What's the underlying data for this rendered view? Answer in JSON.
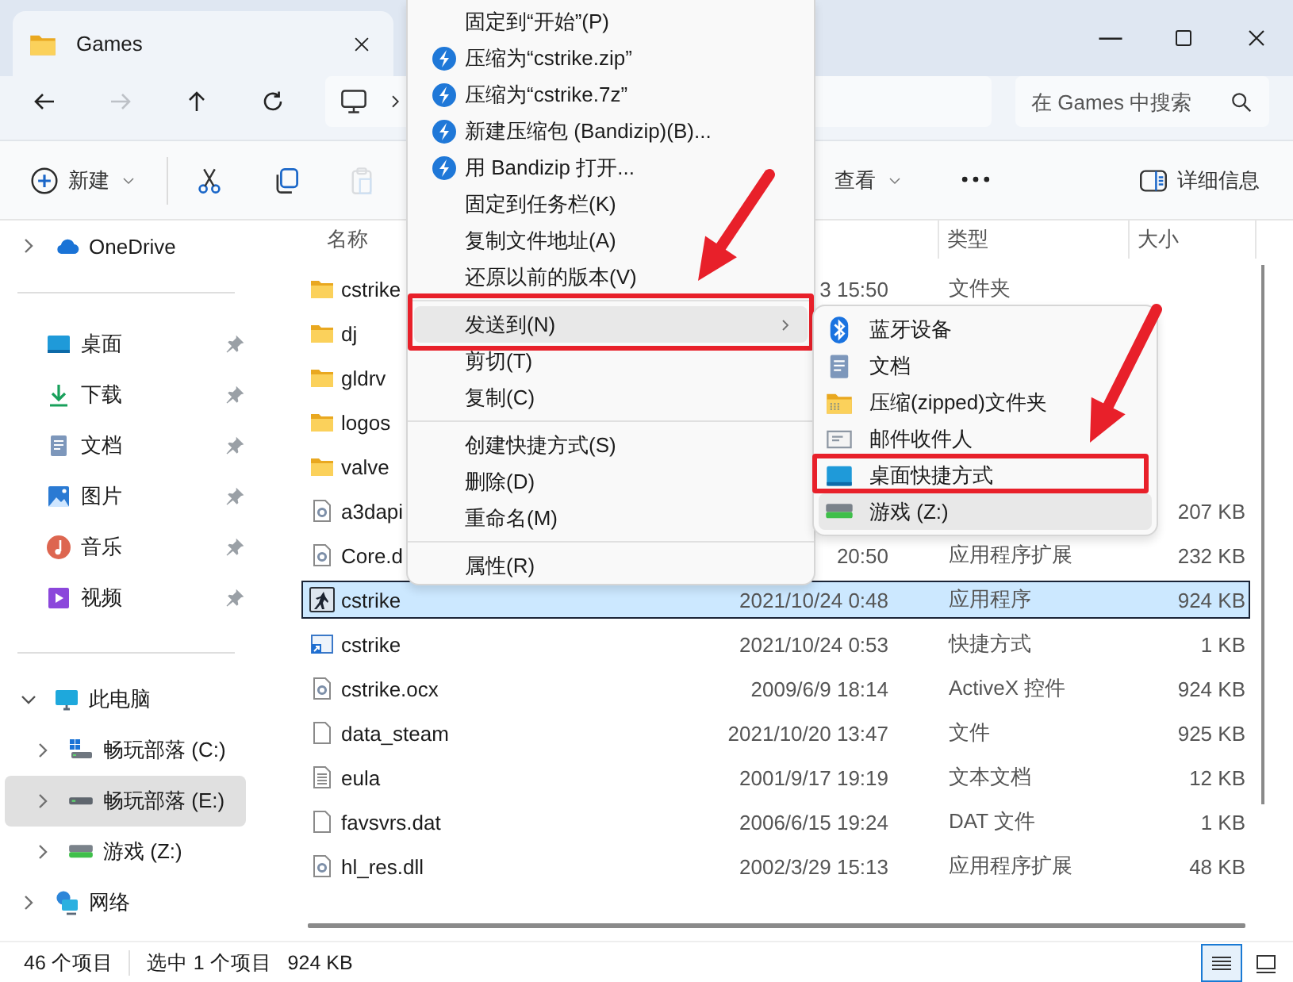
{
  "window": {
    "tab_title": "Games"
  },
  "nav": {
    "buttons": [
      {
        "kind": "back",
        "disabled": false
      },
      {
        "kind": "forward",
        "disabled": true
      },
      {
        "kind": "up",
        "disabled": false
      },
      {
        "kind": "refresh",
        "disabled": false
      }
    ],
    "search_placeholder": "在 Games 中搜索"
  },
  "toolbar": {
    "buttons": [
      {
        "kind": "new",
        "label": "新建",
        "disabled": false
      },
      {
        "kind": "cut",
        "disabled": false
      },
      {
        "kind": "copy",
        "disabled": false
      },
      {
        "kind": "paste",
        "disabled": true
      },
      {
        "kind": "view",
        "label": "查看",
        "disabled": false
      },
      {
        "kind": "more",
        "disabled": false
      },
      {
        "kind": "details",
        "label": "详细信息",
        "disabled": false
      }
    ]
  },
  "sidebar": {
    "sections": [
      {
        "items": [
          {
            "kind": "cloud",
            "label": "OneDrive",
            "expanded": false,
            "selected": false
          }
        ]
      },
      {
        "items": [
          {
            "kind": "desktop",
            "label": "桌面",
            "pinned": true,
            "selected": false
          },
          {
            "kind": "download",
            "label": "下载",
            "pinned": true,
            "selected": false
          },
          {
            "kind": "documents",
            "label": "文档",
            "pinned": true,
            "selected": false
          },
          {
            "kind": "pictures",
            "label": "图片",
            "pinned": true,
            "selected": false
          },
          {
            "kind": "music",
            "label": "音乐",
            "pinned": true,
            "selected": false
          },
          {
            "kind": "video",
            "label": "视频",
            "pinned": true,
            "selected": false
          }
        ]
      },
      {
        "items": [
          {
            "kind": "pc",
            "label": "此电脑",
            "expanded": true,
            "selected": false,
            "children": [
              {
                "kind": "system-drive",
                "label": "畅玩部落 (C:)",
                "expanded": false,
                "selected": false
              },
              {
                "kind": "drive",
                "label": "畅玩部落 (E:)",
                "expanded": false,
                "selected": true
              },
              {
                "kind": "green-drive",
                "label": "游戏 (Z:)",
                "expanded": false,
                "selected": false
              }
            ]
          },
          {
            "kind": "network",
            "label": "网络",
            "expanded": false,
            "selected": false
          }
        ]
      }
    ]
  },
  "table": {
    "columns": [
      {
        "kind": "name",
        "label": "名称"
      },
      {
        "kind": "date"
      },
      {
        "kind": "type",
        "label": "类型"
      },
      {
        "kind": "size",
        "label": "大小"
      }
    ],
    "rows": [
      {
        "kind": "folder",
        "name": "cstrike",
        "date": "3 15:50",
        "type": "文件夹",
        "selected": false
      },
      {
        "kind": "folder",
        "name": "dj",
        "selected": false
      },
      {
        "kind": "folder",
        "name": "gldrv",
        "selected": false
      },
      {
        "kind": "folder",
        "name": "logos",
        "selected": false
      },
      {
        "kind": "folder",
        "name": "valve",
        "selected": false
      },
      {
        "kind": "extension",
        "name": "a3dapi",
        "size": "207 KB",
        "selected": false
      },
      {
        "kind": "extension",
        "name": "Core.d",
        "date": "20:50",
        "type": "应用程序扩展",
        "size": "232 KB",
        "selected": false
      },
      {
        "kind": "game-app",
        "name": "cstrike",
        "date": "2021/10/24 0:48",
        "type": "应用程序",
        "size": "924 KB",
        "selected": true
      },
      {
        "kind": "shortcut",
        "name": "cstrike",
        "date": "2021/10/24 0:53",
        "type": "快捷方式",
        "size": "1 KB",
        "selected": false
      },
      {
        "kind": "extension",
        "name": "cstrike.ocx",
        "date": "2009/6/9 18:14",
        "type": "ActiveX 控件",
        "size": "924 KB",
        "selected": false
      },
      {
        "kind": "file",
        "name": "data_steam",
        "date": "2021/10/20 13:47",
        "type": "文件",
        "size": "925 KB",
        "selected": false
      },
      {
        "kind": "text",
        "name": "eula",
        "date": "2001/9/17 19:19",
        "type": "文本文档",
        "size": "12 KB",
        "selected": false
      },
      {
        "kind": "file",
        "name": "favsvrs.dat",
        "date": "2006/6/15 19:24",
        "type": "DAT 文件",
        "size": "1 KB",
        "selected": false
      },
      {
        "kind": "extension",
        "name": "hl_res.dll",
        "date": "2002/3/29 15:13",
        "type": "应用程序扩展",
        "size": "48 KB",
        "selected": false
      }
    ]
  },
  "context_menu": {
    "items": [
      {
        "kind": "command",
        "label": "固定到“开始”(P)",
        "hovered": false,
        "annotated": false
      },
      {
        "kind": "archive",
        "label": "压缩为“cstrike.zip”",
        "hovered": false,
        "annotated": false
      },
      {
        "kind": "archive",
        "label": "压缩为“cstrike.7z”",
        "hovered": false,
        "annotated": false
      },
      {
        "kind": "archive",
        "label": "新建压缩包 (Bandizip)(B)...",
        "hovered": false,
        "annotated": false
      },
      {
        "kind": "archive",
        "label": "用 Bandizip 打开...",
        "hovered": false,
        "annotated": false
      },
      {
        "kind": "command",
        "label": "固定到任务栏(K)",
        "hovered": false,
        "annotated": false
      },
      {
        "kind": "command",
        "label": "复制文件地址(A)",
        "hovered": false,
        "annotated": false
      },
      {
        "kind": "command",
        "label": "还原以前的版本(V)",
        "hovered": false,
        "annotated": false
      },
      {
        "kind": "separator"
      },
      {
        "kind": "submenu",
        "label": "发送到(N)",
        "hovered": true,
        "annotated": true
      },
      {
        "kind": "command",
        "label": "剪切(T)",
        "hovered": false,
        "annotated": false
      },
      {
        "kind": "command",
        "label": "复制(C)",
        "hovered": false,
        "annotated": false
      },
      {
        "kind": "separator"
      },
      {
        "kind": "command",
        "label": "创建快捷方式(S)",
        "hovered": false,
        "annotated": false
      },
      {
        "kind": "command",
        "label": "删除(D)",
        "hovered": false,
        "annotated": false
      },
      {
        "kind": "command",
        "label": "重命名(M)",
        "hovered": false,
        "annotated": false
      },
      {
        "kind": "separator"
      },
      {
        "kind": "command",
        "label": "属性(R)",
        "hovered": false,
        "annotated": false
      }
    ]
  },
  "send_to_menu": {
    "items": [
      {
        "kind": "bluetooth",
        "label": "蓝牙设备",
        "hovered": false,
        "annotated": false
      },
      {
        "kind": "documents",
        "label": "文档",
        "hovered": false,
        "annotated": false
      },
      {
        "kind": "zip",
        "label": "压缩(zipped)文件夹",
        "hovered": false,
        "annotated": false
      },
      {
        "kind": "mail",
        "label": "邮件收件人",
        "hovered": false,
        "annotated": false
      },
      {
        "kind": "desktop",
        "label": "桌面快捷方式",
        "hovered": false,
        "annotated": true
      },
      {
        "kind": "green-drive",
        "label": "游戏 (Z:)",
        "hovered": true,
        "annotated": false
      }
    ]
  },
  "status_bar": {
    "texts": [
      "46 个项目",
      "选中 1 个项目",
      "924 KB"
    ],
    "views": [
      {
        "kind": "details",
        "selected": true
      },
      {
        "kind": "tiles",
        "selected": false
      }
    ]
  }
}
